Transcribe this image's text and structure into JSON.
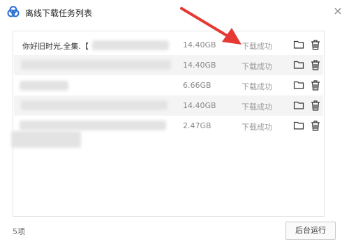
{
  "window": {
    "title": "离线下载任务列表",
    "close_label": "×"
  },
  "tasks": [
    {
      "name": "你好旧时光.全集.【",
      "size": "14.40GB",
      "status": "下载成功"
    },
    {
      "name": "",
      "size": "14.40GB",
      "status": "下载成功"
    },
    {
      "name": "",
      "size": "6.66GB",
      "status": "下载成功"
    },
    {
      "name": "",
      "size": "14.40GB",
      "status": "下载成功"
    },
    {
      "name": "",
      "size": "2.47GB",
      "status": "下载成功"
    }
  ],
  "footer": {
    "count": "5项",
    "background_button": "后台运行"
  },
  "colors": {
    "arrow": "#e53935",
    "logo": "#2a6dd3"
  }
}
